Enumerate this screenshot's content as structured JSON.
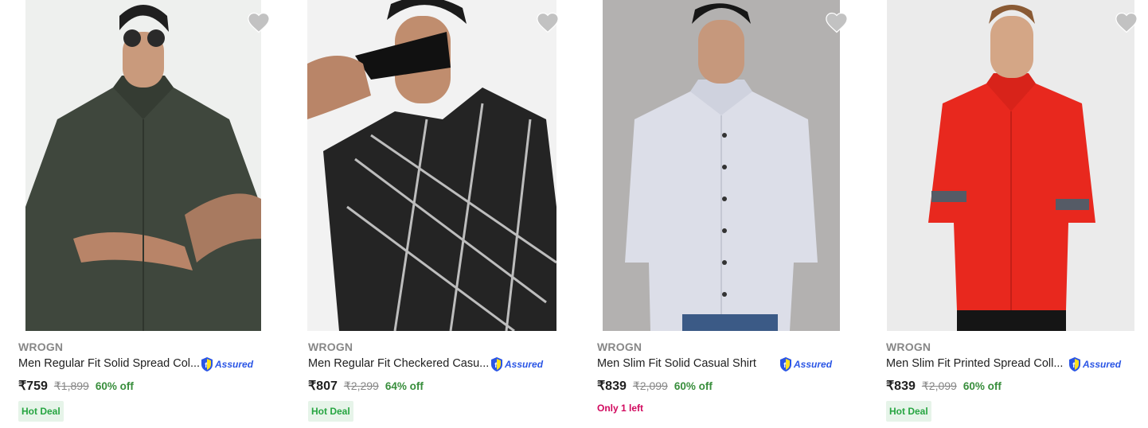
{
  "colors": {
    "offer_green": "#388e3c",
    "deal_bg": "#e6f4e9",
    "deal_text": "#26a541",
    "stock_pink": "#d1085e",
    "assured_blue": "#2a55e5",
    "wishlist_grey": "#c2c2c2"
  },
  "products": [
    {
      "image": "dark olive short-sleeve shirt",
      "brand": "WROGN",
      "title": "Men Regular Fit Solid Spread Col...",
      "assured": "Assured",
      "price": "₹759",
      "mrp": "₹1,899",
      "discount": "60% off",
      "tag": "Hot Deal"
    },
    {
      "image": "black checkered shirt",
      "brand": "WROGN",
      "title": "Men Regular Fit Checkered Casu...",
      "assured": "Assured",
      "price": "₹807",
      "mrp": "₹2,299",
      "discount": "64% off",
      "tag": "Hot Deal"
    },
    {
      "image": "light grey slim fit shirt",
      "brand": "WROGN",
      "title": "Men Slim Fit Solid Casual Shirt",
      "assured": "Assured",
      "price": "₹839",
      "mrp": "₹2,099",
      "discount": "60% off",
      "stock": "Only 1 left"
    },
    {
      "image": "red printed shirt",
      "brand": "WROGN",
      "title": "Men Slim Fit Printed Spread Coll...",
      "assured": "Assured",
      "price": "₹839",
      "mrp": "₹2,099",
      "discount": "60% off",
      "tag": "Hot Deal"
    }
  ]
}
